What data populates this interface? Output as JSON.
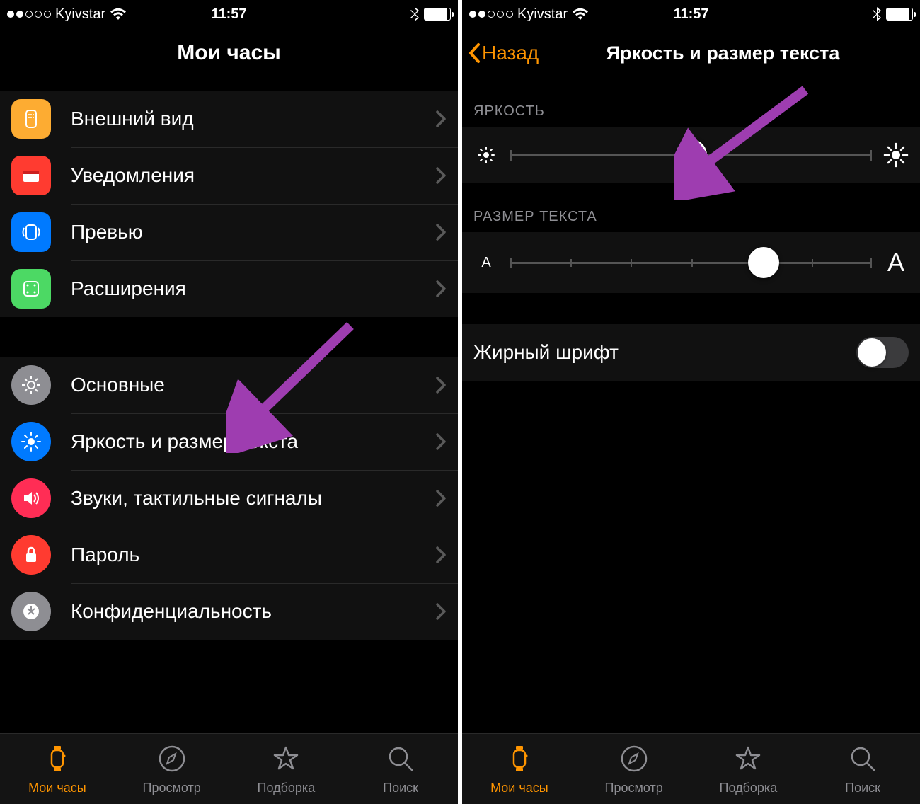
{
  "status": {
    "carrier": "Kyivstar",
    "time": "11:57"
  },
  "left": {
    "title": "Мои часы",
    "group1": [
      {
        "label": "Внешний вид",
        "icon": "appearance-icon",
        "color": "#fdac32",
        "shape": "round"
      },
      {
        "label": "Уведомления",
        "icon": "notifications-icon",
        "color": "#ff3b30",
        "shape": "round"
      },
      {
        "label": "Превью",
        "icon": "preview-icon",
        "color": "#007aff",
        "shape": "round"
      },
      {
        "label": "Расширения",
        "icon": "extensions-icon",
        "color": "#4cd964",
        "shape": "round"
      }
    ],
    "group2": [
      {
        "label": "Основные",
        "icon": "gear-icon",
        "color": "#8e8e93",
        "shape": "circle"
      },
      {
        "label": "Яркость и размер текста",
        "icon": "brightness-icon",
        "color": "#007aff",
        "shape": "circle"
      },
      {
        "label": "Звуки, тактильные сигналы",
        "icon": "sounds-icon",
        "color": "#ff2d55",
        "shape": "circle"
      },
      {
        "label": "Пароль",
        "icon": "lock-icon",
        "color": "#ff3b30",
        "shape": "circle"
      },
      {
        "label": "Конфиденциальность",
        "icon": "privacy-icon",
        "color": "#8e8e93",
        "shape": "circle"
      }
    ]
  },
  "right": {
    "back": "Назад",
    "title": "Яркость и размер текста",
    "brightness_label": "ЯРКОСТЬ",
    "brightness_value": 50,
    "text_size_label": "РАЗМЕР ТЕКСТА",
    "text_size_value": 70,
    "text_size_min": "A",
    "text_size_max": "A",
    "bold_label": "Жирный шрифт",
    "bold_on": false
  },
  "tabs": [
    {
      "label": "Мои часы",
      "icon": "my-watch-icon",
      "active": true
    },
    {
      "label": "Просмотр",
      "icon": "browse-icon",
      "active": false
    },
    {
      "label": "Подборка",
      "icon": "featured-icon",
      "active": false
    },
    {
      "label": "Поиск",
      "icon": "search-icon",
      "active": false
    }
  ],
  "colors": {
    "accent": "#ff9500",
    "arrow": "#9e3db0"
  }
}
